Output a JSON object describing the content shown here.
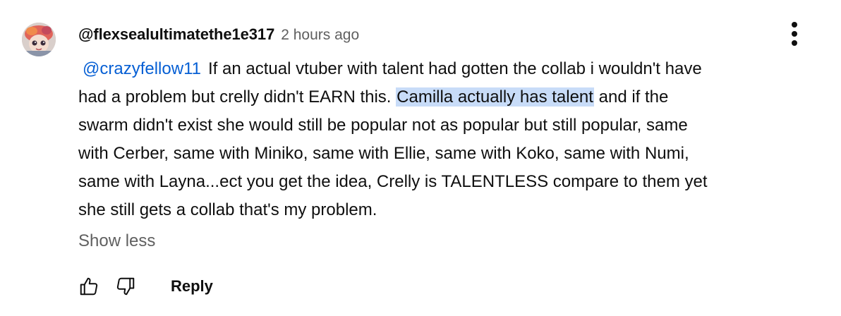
{
  "comment": {
    "author": "@flexsealultimatethe1e317",
    "timestamp": "2 hours ago",
    "mention": "@crazyfellow11",
    "lines": [
      {
        "before": "If an actual vtuber with talent had gotten the collab i wouldn't have"
      },
      {
        "before": "had a problem but crelly didn't EARN this. ",
        "highlight": "Camilla actually has talent",
        "after": " and if the"
      },
      {
        "before": "swarm didn't exist she would still be popular not as popular but still popular, same"
      },
      {
        "before": "with Cerber, same with Miniko, same with Ellie, same with Koko, same with Numi,"
      },
      {
        "before": "same with Layna...ect you get the idea, Crelly is TALENTLESS compare to them yet"
      },
      {
        "before": "she still gets a collab that's my problem."
      }
    ],
    "show_less_label": "Show less",
    "reply_label": "Reply"
  },
  "icons": {
    "avatar": "avatar-image",
    "menu": "more-vert-icon",
    "like": "thumbs-up-icon",
    "dislike": "thumbs-down-icon"
  },
  "colors": {
    "text": "#0f0f0f",
    "secondary": "#606060",
    "mention": "#065fd4",
    "highlight": "#c8dcf8"
  }
}
